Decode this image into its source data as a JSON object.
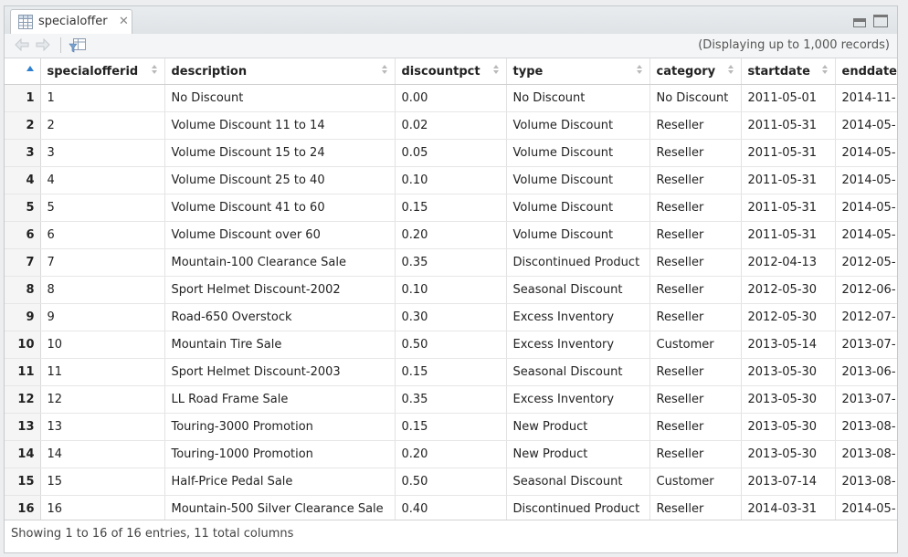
{
  "tab": {
    "title": "specialoffer"
  },
  "toolbar": {
    "records_label": "(Displaying up to 1,000 records)"
  },
  "columns": [
    "specialofferid",
    "description",
    "discountpct",
    "type",
    "category",
    "startdate",
    "enddate"
  ],
  "rows": [
    {
      "n": "1",
      "id": "1",
      "description": "No Discount",
      "discountpct": "0.00",
      "type": "No Discount",
      "category": "No Discount",
      "startdate": "2011-05-01",
      "enddate": "2014-11-"
    },
    {
      "n": "2",
      "id": "2",
      "description": "Volume Discount 11 to 14",
      "discountpct": "0.02",
      "type": "Volume Discount",
      "category": "Reseller",
      "startdate": "2011-05-31",
      "enddate": "2014-05-"
    },
    {
      "n": "3",
      "id": "3",
      "description": "Volume Discount 15 to 24",
      "discountpct": "0.05",
      "type": "Volume Discount",
      "category": "Reseller",
      "startdate": "2011-05-31",
      "enddate": "2014-05-"
    },
    {
      "n": "4",
      "id": "4",
      "description": "Volume Discount 25 to 40",
      "discountpct": "0.10",
      "type": "Volume Discount",
      "category": "Reseller",
      "startdate": "2011-05-31",
      "enddate": "2014-05-"
    },
    {
      "n": "5",
      "id": "5",
      "description": "Volume Discount 41 to 60",
      "discountpct": "0.15",
      "type": "Volume Discount",
      "category": "Reseller",
      "startdate": "2011-05-31",
      "enddate": "2014-05-"
    },
    {
      "n": "6",
      "id": "6",
      "description": "Volume Discount over 60",
      "discountpct": "0.20",
      "type": "Volume Discount",
      "category": "Reseller",
      "startdate": "2011-05-31",
      "enddate": "2014-05-"
    },
    {
      "n": "7",
      "id": "7",
      "description": "Mountain-100 Clearance Sale",
      "discountpct": "0.35",
      "type": "Discontinued Product",
      "category": "Reseller",
      "startdate": "2012-04-13",
      "enddate": "2012-05-"
    },
    {
      "n": "8",
      "id": "8",
      "description": "Sport Helmet Discount-2002",
      "discountpct": "0.10",
      "type": "Seasonal Discount",
      "category": "Reseller",
      "startdate": "2012-05-30",
      "enddate": "2012-06-"
    },
    {
      "n": "9",
      "id": "9",
      "description": "Road-650 Overstock",
      "discountpct": "0.30",
      "type": "Excess Inventory",
      "category": "Reseller",
      "startdate": "2012-05-30",
      "enddate": "2012-07-"
    },
    {
      "n": "10",
      "id": "10",
      "description": "Mountain Tire Sale",
      "discountpct": "0.50",
      "type": "Excess Inventory",
      "category": "Customer",
      "startdate": "2013-05-14",
      "enddate": "2013-07-"
    },
    {
      "n": "11",
      "id": "11",
      "description": "Sport Helmet Discount-2003",
      "discountpct": "0.15",
      "type": "Seasonal Discount",
      "category": "Reseller",
      "startdate": "2013-05-30",
      "enddate": "2013-06-"
    },
    {
      "n": "12",
      "id": "12",
      "description": "LL Road Frame Sale",
      "discountpct": "0.35",
      "type": "Excess Inventory",
      "category": "Reseller",
      "startdate": "2013-05-30",
      "enddate": "2013-07-"
    },
    {
      "n": "13",
      "id": "13",
      "description": "Touring-3000 Promotion",
      "discountpct": "0.15",
      "type": "New Product",
      "category": "Reseller",
      "startdate": "2013-05-30",
      "enddate": "2013-08-"
    },
    {
      "n": "14",
      "id": "14",
      "description": "Touring-1000 Promotion",
      "discountpct": "0.20",
      "type": "New Product",
      "category": "Reseller",
      "startdate": "2013-05-30",
      "enddate": "2013-08-"
    },
    {
      "n": "15",
      "id": "15",
      "description": "Half-Price Pedal Sale",
      "discountpct": "0.50",
      "type": "Seasonal Discount",
      "category": "Customer",
      "startdate": "2013-07-14",
      "enddate": "2013-08-"
    },
    {
      "n": "16",
      "id": "16",
      "description": "Mountain-500 Silver Clearance Sale",
      "discountpct": "0.40",
      "type": "Discontinued Product",
      "category": "Reseller",
      "startdate": "2014-03-31",
      "enddate": "2014-05-"
    }
  ],
  "status": {
    "text": "Showing 1 to 16 of 16 entries, 11 total columns"
  },
  "colors": {
    "sort_active": "#2f7fd1",
    "sort_inactive": "#b9b9b9",
    "rownum_bg": "#f5f5f5"
  },
  "icons": [
    "table-icon",
    "close-icon",
    "minimize-icon",
    "maximize-icon",
    "back-arrow-icon",
    "forward-arrow-icon",
    "filter-icon",
    "sort-icon"
  ]
}
